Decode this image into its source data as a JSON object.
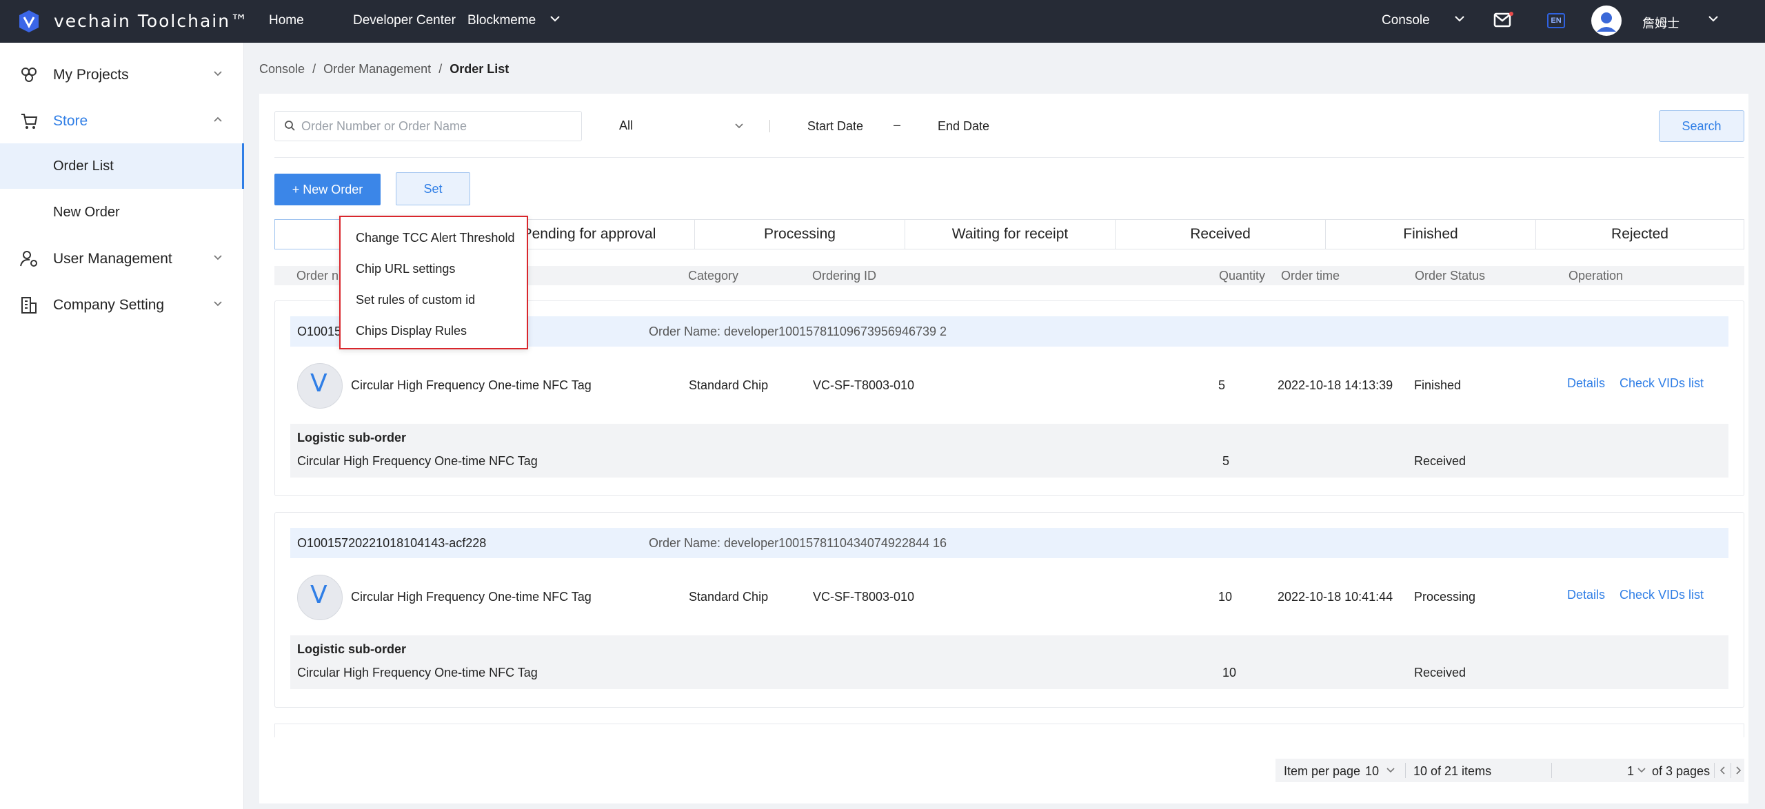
{
  "topbar": {
    "logo_text": "vechain Toolchain™",
    "nav": [
      "Home",
      "Developer Center",
      "Blockmeme"
    ],
    "console_label": "Console",
    "lang_badge": "EN",
    "username": "詹姆士",
    "colors": {
      "bg": "#262b36",
      "logo_blue": "#3b66e8",
      "badge": "#2f62e0"
    }
  },
  "sidebar": {
    "items": [
      {
        "label": "My Projects",
        "icon": "projects-icon"
      },
      {
        "label": "Store",
        "icon": "cart-icon"
      },
      {
        "label": "User Management",
        "icon": "user-settings-icon"
      },
      {
        "label": "Company Setting",
        "icon": "building-icon"
      }
    ],
    "store_sub": [
      {
        "label": "Order List"
      },
      {
        "label": "New Order"
      }
    ]
  },
  "breadcrumb": [
    "Console",
    "Order Management",
    "Order List"
  ],
  "filters": {
    "search_placeholder": "Order Number or Order Name",
    "status_value": "All",
    "start_date": "Start Date",
    "date_dash": "–",
    "end_date": "End Date",
    "search_label": "Search"
  },
  "actions": {
    "new_order": "+ New Order",
    "set": "Set"
  },
  "tabs": [
    "",
    "Pending for approval",
    "Processing",
    "Waiting for receipt",
    "Received",
    "Finished",
    "Rejected"
  ],
  "table_headers": {
    "order_number": "Order n",
    "category": "Category",
    "ordering_id": "Ordering ID",
    "quantity": "Quantity",
    "order_time": "Order time",
    "order_status": "Order Status",
    "operation": "Operation"
  },
  "orders": [
    {
      "number": "O10015",
      "name": "Order Name: developer10015781109673956946739 2",
      "product": "Circular High Frequency One-time NFC Tag",
      "category": "Standard Chip",
      "ordering_id": "VC-SF-T8003-010",
      "quantity": "5",
      "time": "2022-10-18 14:13:39",
      "status": "Finished",
      "details": "Details",
      "vids": "Check VIDs list",
      "sub_title": "Logistic sub-order",
      "sub_product": "Circular High Frequency One-time NFC Tag",
      "sub_quantity": "5",
      "sub_status": "Received"
    },
    {
      "number": "O10015720221018104143-acf228",
      "name": "Order Name: developer1001578110434074922844 16",
      "product": "Circular High Frequency One-time NFC Tag",
      "category": "Standard Chip",
      "ordering_id": "VC-SF-T8003-010",
      "quantity": "10",
      "time": "2022-10-18 10:41:44",
      "status": "Processing",
      "details": "Details",
      "vids": "Check VIDs list",
      "sub_title": "Logistic sub-order",
      "sub_product": "Circular High Frequency One-time NFC Tag",
      "sub_quantity": "10",
      "sub_status": "Received"
    }
  ],
  "pagination": {
    "per_page_label": "Item per page",
    "per_page_value": "10",
    "items_info": "10 of 21 items",
    "current_page": "1",
    "pages_info": "of 3 pages"
  },
  "set_menu": [
    "Change TCC Alert Threshold",
    "Chip URL settings",
    "Set rules of custom id",
    "Chips Display Rules"
  ]
}
